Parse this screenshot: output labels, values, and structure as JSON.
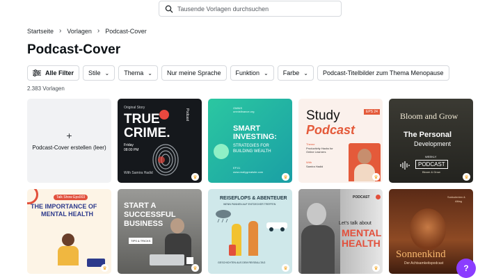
{
  "search": {
    "placeholder": "Tausende Vorlagen durchsuchen"
  },
  "breadcrumb": [
    "Startseite",
    "Vorlagen",
    "Podcast-Cover"
  ],
  "page_title": "Podcast-Cover",
  "filters": {
    "all": "Alle Filter",
    "stil": "Stile",
    "thema": "Thema",
    "sprache": "Nur meine Sprache",
    "funktion": "Funktion",
    "farbe": "Farbe",
    "menopause": "Podcast-Titelbilder zum Thema Menopause"
  },
  "count": "2.383 Vorlagen",
  "create_card": {
    "plus": "+",
    "label": "Podcast-Cover erstellen (leer)"
  },
  "templates": {
    "t1": {
      "top": "Original Story",
      "title1": "TRUE",
      "title2": "CRIME.",
      "time1": "Friday",
      "time2": "08:00 PM",
      "side": "Podcast",
      "host": "With Samira Hadid"
    },
    "t2": {
      "top1": "OMNIS",
      "top2": "omnisfinance.org",
      "title1": "SMART",
      "title2": "INVESTING:",
      "sub1": "STRATEGIES FOR",
      "sub2": "BUILDING WEALTH",
      "ep": "EP.01",
      "site": "www.reallygreatsite.com"
    },
    "t3": {
      "title1": "Study",
      "title2": "Podcast",
      "ep": "EPS 24",
      "t_label": "Theme",
      "theme1": "Productivity Hacks for",
      "theme2": "Online Learners",
      "with": "With",
      "host": "Samira Hadid"
    },
    "t4": {
      "title": "Bloom and Grow",
      "sub1": "The Personal",
      "sub2": "Development",
      "weekly": "WEEKLY",
      "badge": "PODCAST",
      "host": "Bloom & Grow"
    },
    "t5": {
      "tag": "Talk Show Eps003",
      "line1": "THE IMPORTANCE OF",
      "line2": "MENTAL HEALTH"
    },
    "t6": {
      "line1": "START A",
      "line2": "SUCCESSFUL",
      "line3": "BUSINESS",
      "tag": "TIPS & TRICKS"
    },
    "t7": {
      "title": "REISEFLOPS & ABENTEUER",
      "sub": "WENN PANNEN AUF ENTDECKER TREFFEN",
      "foot": "GESCHICHTEN AUS DEM REISEALLTAG"
    },
    "t8": {
      "tag": "PODCAST",
      "line1": "Let's talk about",
      "line2": "MENTAL",
      "line3": "HEALTH"
    },
    "t9": {
      "top1": "Sukkulenten &",
      "top2": "Alltag",
      "title": "Sonnenkind",
      "sub": "Der Achtsamkeitspodcast"
    }
  },
  "help": "?",
  "colors": {
    "accent": "#8b3dff",
    "crown": "#f4a623"
  }
}
